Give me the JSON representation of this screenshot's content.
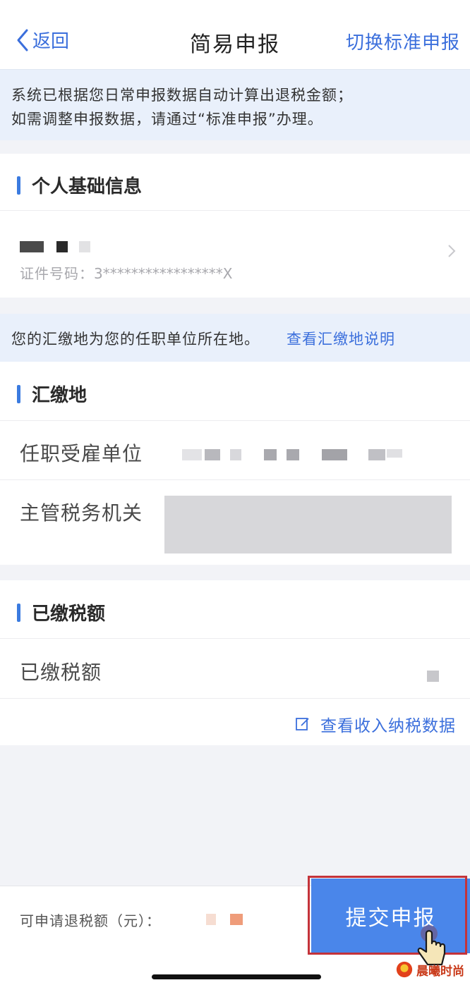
{
  "nav": {
    "back_label": "返回",
    "title": "简易申报",
    "switch_label": "切换标准申报"
  },
  "notice": {
    "line1": "系统已根据您日常申报数据自动计算出退税金额；",
    "line2": "如需调整申报数据，请通过“标准申报”办理。"
  },
  "personal": {
    "section_title": "个人基础信息",
    "id_label": "证件号码：",
    "id_value": "3*****************X"
  },
  "hint": {
    "text": "您的汇缴地为您的任职单位所在地。",
    "link": "查看汇缴地说明"
  },
  "location": {
    "section_title": "汇缴地",
    "employer_label": "任职受雇单位",
    "tax_office_label": "主管税务机关"
  },
  "tax_paid": {
    "section_title": "已缴税额",
    "row_label": "已缴税额",
    "link_label": "查看收入纳税数据"
  },
  "bottom": {
    "refund_label": "可申请退税额（元）：",
    "submit_label": "提交申报"
  },
  "watermark": {
    "text": "晨曦时尚"
  },
  "colors": {
    "accent": "#3b6fdc",
    "submit_bg": "#4a86ea",
    "notice_bg": "#e9f0fb",
    "highlight": "#c4333a"
  }
}
